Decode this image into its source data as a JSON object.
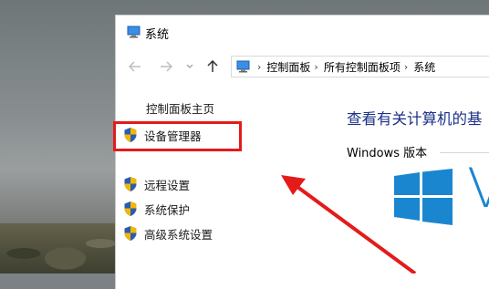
{
  "window": {
    "title": "系统"
  },
  "navigation": {
    "back_icon": "arrow-left-icon",
    "forward_icon": "arrow-right-icon",
    "recent_icon": "chevron-down-icon",
    "up_icon": "arrow-up-icon"
  },
  "address_bar": {
    "icon": "control-panel-icon",
    "crumbs": [
      "控制面板",
      "所有控制面板项",
      "系统"
    ]
  },
  "left_pane": {
    "home_link": "控制面板主页",
    "tasks": [
      {
        "label": "设备管理器",
        "icon": "uac-shield-icon"
      },
      {
        "label": "远程设置",
        "icon": "uac-shield-icon"
      },
      {
        "label": "系统保护",
        "icon": "uac-shield-icon"
      },
      {
        "label": "高级系统设置",
        "icon": "uac-shield-icon"
      }
    ]
  },
  "main": {
    "heading": "查看有关计算机的基",
    "section_title": "Windows 版本",
    "wordmark": "V"
  },
  "annotations": {
    "highlight_color": "#e31b1b",
    "arrow_color": "#e31b1b"
  },
  "colors": {
    "heading": "#1e3287",
    "windows_blue": "#1a86d0"
  }
}
